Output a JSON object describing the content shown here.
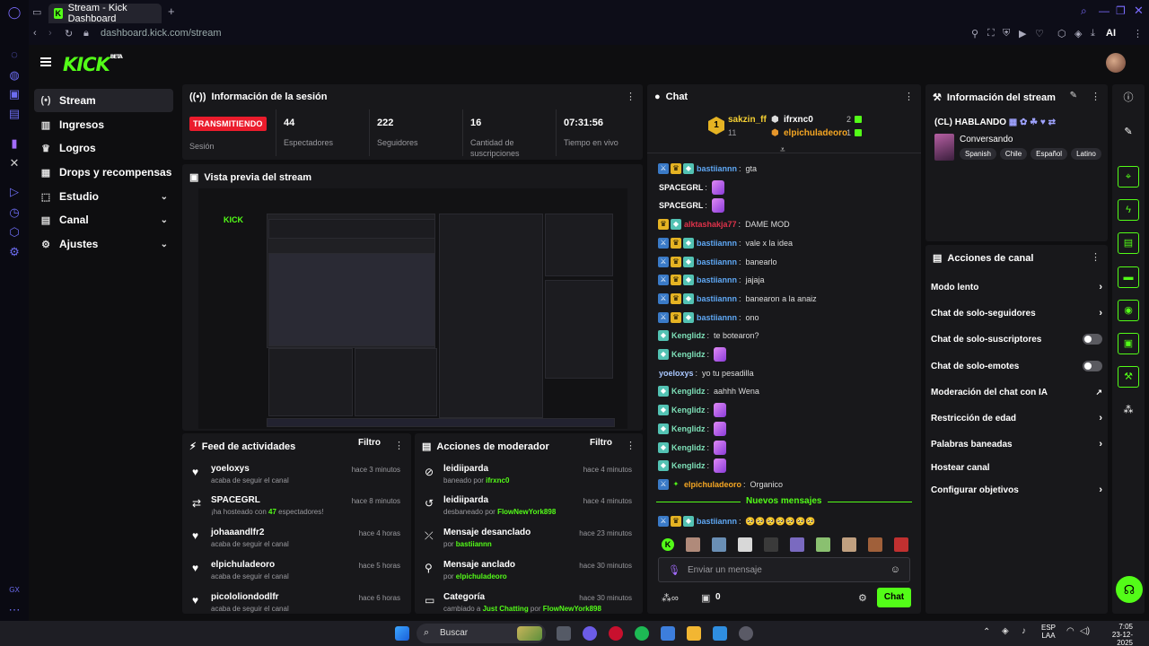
{
  "browser": {
    "tab_title": "Stream - Kick Dashboard",
    "url": "dashboard.kick.com/stream",
    "ai_label": "AI"
  },
  "brand": {
    "logo": "KICK",
    "beta": "BETA"
  },
  "sidebar": {
    "items": [
      {
        "label": "Stream",
        "icon": "broadcast-icon",
        "active": true
      },
      {
        "label": "Ingresos",
        "icon": "chart-icon"
      },
      {
        "label": "Logros",
        "icon": "trophy-icon"
      },
      {
        "label": "Drops y recompensas",
        "icon": "gift-icon"
      },
      {
        "label": "Estudio",
        "icon": "studio-icon",
        "expandable": true
      },
      {
        "label": "Canal",
        "icon": "channel-icon",
        "expandable": true
      },
      {
        "label": "Ajustes",
        "icon": "gear-icon",
        "expandable": true
      }
    ]
  },
  "session": {
    "title": "Información de la sesión",
    "live_badge": "TRANSMITIENDO",
    "live_label": "Sesión",
    "stats": [
      {
        "value": "44",
        "label": "Espectadores"
      },
      {
        "value": "222",
        "label": "Seguidores"
      },
      {
        "value": "16",
        "label": "Cantidad de suscripciones"
      },
      {
        "value": "07:31:56",
        "label": "Tiempo en vivo"
      }
    ]
  },
  "preview": {
    "title": "Vista previa del stream"
  },
  "activity_feed": {
    "title": "Feed de actividades",
    "filter": "Filtro",
    "items": [
      {
        "icon": "heart-icon",
        "name": "yoeloxys",
        "sub": "acaba de seguir el canal",
        "time": "hace 3 minutos"
      },
      {
        "icon": "host-icon",
        "name": "SPACEGRL",
        "sub_pre": "¡ha hosteado con ",
        "sub_num": "47",
        "sub_post": " espectadores!",
        "time": "hace 8 minutos"
      },
      {
        "icon": "heart-icon",
        "name": "johaaandlfr2",
        "sub": "acaba de seguir el canal",
        "time": "hace 4 horas"
      },
      {
        "icon": "heart-icon",
        "name": "elpichuladeoro",
        "sub": "acaba de seguir el canal",
        "time": "hace 5 horas"
      },
      {
        "icon": "heart-icon",
        "name": "picololiondodlfr",
        "sub": "acaba de seguir el canal",
        "time": "hace 6 horas"
      }
    ]
  },
  "mod_actions": {
    "title": "Acciones de moderador",
    "filter": "Filtro",
    "items": [
      {
        "icon": "ban-icon",
        "name": "leidiiparda",
        "sub_pre": "baneado por ",
        "sub_user": "ifrxnc0",
        "time": "hace 4 minutos"
      },
      {
        "icon": "unban-icon",
        "name": "leidiiparda",
        "sub_pre": "desbaneado por ",
        "sub_user": "FlowNewYork898",
        "time": "hace 4 minutos"
      },
      {
        "icon": "unpin-icon",
        "name": "Mensaje desanclado",
        "sub_pre": "por ",
        "sub_user": "bastiiannn",
        "time": "hace 23 minutos"
      },
      {
        "icon": "pin-icon",
        "name": "Mensaje anclado",
        "sub_pre": "por ",
        "sub_user": "elpichuladeoro",
        "time": "hace 30 minutos"
      },
      {
        "icon": "category-icon",
        "name": "Categoría",
        "sub_pre": "cambiado a ",
        "sub_user": "Just Chatting",
        "sub_mid": " por ",
        "sub_user2": "FlowNewYork898",
        "time": "hace 30 minutos"
      }
    ]
  },
  "chat": {
    "title": "Chat",
    "top_gifter": {
      "name": "sakzin_ff",
      "count": "11"
    },
    "gifters": [
      {
        "name": "ifrxnc0",
        "count": "2"
      },
      {
        "name": "elpichuladeoro",
        "count": "1"
      }
    ],
    "messages": [
      {
        "user": "bastiiannn",
        "color": "#5fa8f5",
        "badges": [
          "blue",
          "crown",
          "sub"
        ],
        "text": "gta"
      },
      {
        "user": "SPACEGRL",
        "color": "#ffffff",
        "badges": [],
        "text": "",
        "emote": true
      },
      {
        "user": "SPACEGRL",
        "color": "#ffffff",
        "badges": [],
        "text": "",
        "emote": true
      },
      {
        "user": "alktashakja77",
        "color": "#e0324a",
        "badges": [
          "crown",
          "sub"
        ],
        "text": "DAME MOD"
      },
      {
        "user": "bastiiannn",
        "color": "#5fa8f5",
        "badges": [
          "blue",
          "crown",
          "sub"
        ],
        "text": "vale x la idea"
      },
      {
        "user": "bastiiannn",
        "color": "#5fa8f5",
        "badges": [
          "blue",
          "crown",
          "sub"
        ],
        "text": "banearlo"
      },
      {
        "user": "bastiiannn",
        "color": "#5fa8f5",
        "badges": [
          "blue",
          "crown",
          "sub"
        ],
        "text": "jajaja"
      },
      {
        "user": "bastiiannn",
        "color": "#5fa8f5",
        "badges": [
          "blue",
          "crown",
          "sub"
        ],
        "text": "banearon a la anaiz"
      },
      {
        "user": "bastiiannn",
        "color": "#5fa8f5",
        "badges": [
          "blue",
          "crown",
          "sub"
        ],
        "text": "ono"
      },
      {
        "user": "Kenglidz",
        "color": "#7ee0b8",
        "badges": [
          "sub"
        ],
        "text": "te botearon?"
      },
      {
        "user": "Kenglidz",
        "color": "#7ee0b8",
        "badges": [
          "sub"
        ],
        "text": "",
        "emote": true
      },
      {
        "user": "yoeloxys",
        "color": "#a9c7ff",
        "badges": [],
        "text": "yo tu pesadilla"
      },
      {
        "user": "Kenglidz",
        "color": "#7ee0b8",
        "badges": [
          "sub"
        ],
        "text": "aahhh Wena"
      },
      {
        "user": "Kenglidz",
        "color": "#7ee0b8",
        "badges": [
          "sub"
        ],
        "text": "",
        "emote": true
      },
      {
        "user": "Kenglidz",
        "color": "#7ee0b8",
        "badges": [
          "sub"
        ],
        "text": "",
        "emote": true
      },
      {
        "user": "Kenglidz",
        "color": "#7ee0b8",
        "badges": [
          "sub"
        ],
        "text": "",
        "emote": true
      },
      {
        "user": "Kenglidz",
        "color": "#7ee0b8",
        "badges": [
          "sub"
        ],
        "text": "",
        "emote": true
      },
      {
        "user": "elpichuladeoro",
        "color": "#f5a623",
        "badges": [
          "blue",
          "star"
        ],
        "text": "Organico"
      }
    ],
    "new_messages": "Nuevos mensajes",
    "last_message": {
      "user": "bastiiannn",
      "text": "🥺🥺🥺🥺🥺🥺🥺"
    },
    "input_placeholder": "Enviar un mensaje",
    "points": "0",
    "send_label": "Chat"
  },
  "stream_info": {
    "title": "Información del stream",
    "stream_title": "(CL) HABLANDO",
    "category": "Conversando",
    "tags": [
      "Spanish",
      "Chile",
      "Español",
      "Latino"
    ]
  },
  "channel_actions": {
    "title": "Acciones de canal",
    "items": [
      {
        "label": "Modo lento",
        "control": "chevron"
      },
      {
        "label": "Chat de solo-seguidores",
        "control": "chevron"
      },
      {
        "label": "Chat de solo-suscriptores",
        "control": "toggle"
      },
      {
        "label": "Chat de solo-emotes",
        "control": "toggle"
      },
      {
        "label": "Moderación del chat con IA",
        "control": "external"
      },
      {
        "label": "Restricción de edad",
        "control": "chevron"
      },
      {
        "label": "Palabras baneadas",
        "control": "chevron"
      },
      {
        "label": "Hostear canal",
        "control": "none"
      },
      {
        "label": "Configurar objetivos",
        "control": "chevron"
      }
    ]
  },
  "taskbar": {
    "search": "Buscar",
    "lang": "ESP",
    "lang2": "LAA",
    "time": "7:05",
    "date": "23-12-2025"
  },
  "colors": {
    "accent": "#53fc18",
    "live": "#eb1c2c",
    "panel": "#18181b",
    "bg": "#0e0e10"
  }
}
